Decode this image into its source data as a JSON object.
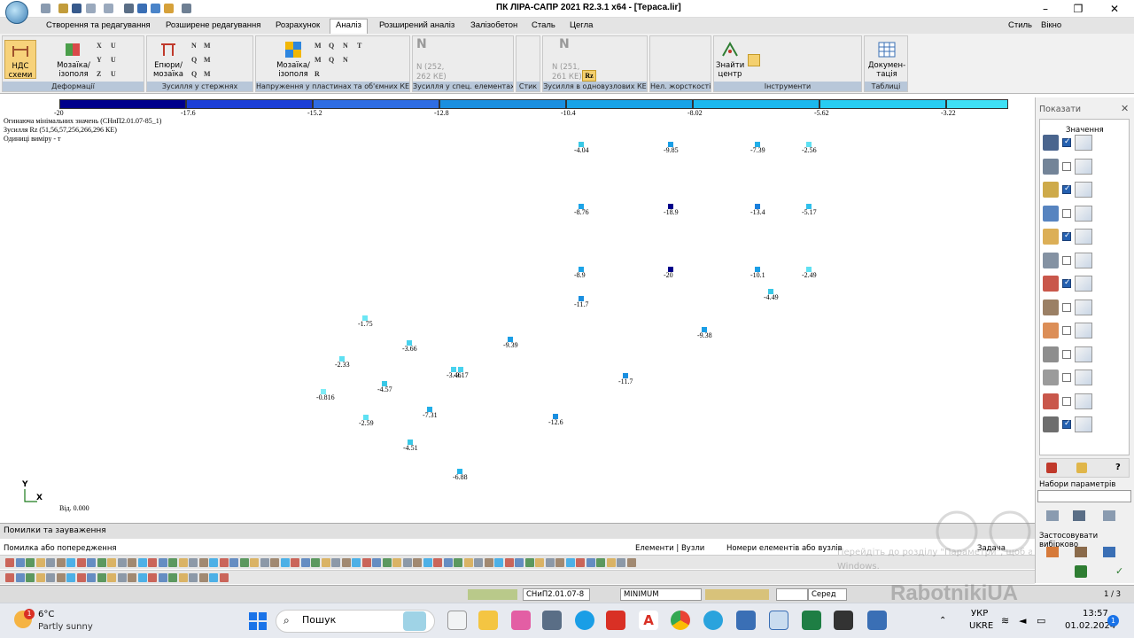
{
  "window": {
    "title": "ПК ЛІРА-САПР  2021 R2.3.1 x64 - [Тераса.lir]",
    "controls": [
      "–",
      "❐",
      "✕"
    ]
  },
  "menu": {
    "tabs": [
      "Створення та редагування",
      "Розширене редагування",
      "Розрахунок",
      "Аналіз",
      "Розширений аналіз",
      "Залізобетон",
      "Сталь",
      "Цегла"
    ],
    "right": [
      "Стиль",
      "Вікно"
    ],
    "active_index": 3
  },
  "ribbon": {
    "groups": [
      {
        "label": "Деформації",
        "buttons": [
          "НДС схеми",
          "Мозаїка/ізополя"
        ],
        "small": [
          "X",
          "Y",
          "Z",
          "U",
          "U",
          "U"
        ]
      },
      {
        "label": "Зусилля у стержнях",
        "buttons": [
          "Епюри/мозаїка"
        ],
        "small": [
          "N",
          "M",
          "Q",
          "M",
          "Q",
          "M"
        ]
      },
      {
        "label": "Напруження у пластинах та об'ємних КЕ",
        "buttons": [
          "Мозаїка/ізополя"
        ],
        "small": [
          "M",
          "Q",
          "N",
          "T",
          "M",
          "Q",
          "N",
          "R"
        ]
      },
      {
        "label": "Зусилля у спец. елементах",
        "disabled_text": [
          "N (252,",
          "262 КЕ)"
        ]
      },
      {
        "label": "Стик"
      },
      {
        "label": "Зусилля в одновузлових КЕ",
        "disabled_text": [
          "N (251,",
          "261 КЕ)"
        ],
        "selected": "Rz"
      },
      {
        "label": "Нел. жорсткості"
      },
      {
        "label": "Інструменти",
        "buttons": [
          "Знайти центр"
        ]
      },
      {
        "label": "Таблиці",
        "buttons": [
          "Докумен-тація"
        ]
      }
    ]
  },
  "scale": {
    "labels": [
      "-20",
      "-17.6",
      "-15.2",
      "-12.8",
      "-10.4",
      "-8.02",
      "-5.62",
      "-3.22"
    ],
    "colors": [
      "#00008b",
      "#1c3fd6",
      "#2f6de3",
      "#1a8fe0",
      "#18a3e8",
      "#1bb8ee",
      "#27cdf2",
      "#3fe0f5"
    ]
  },
  "canvas": {
    "info": [
      "Огинаюча мінімальних значень (СНиП2.01.07-85_1)",
      "Зусилля Rz (51,56,57,256,266,296 КЕ)",
      "Одиниці виміру - т"
    ],
    "axis_y": "Y",
    "axis_x": "X",
    "offset_label": "Від. 0.000",
    "points": [
      {
        "v": "-4.04",
        "c": "#39c8e6"
      },
      {
        "v": "-9.85",
        "c": "#1a9ee6"
      },
      {
        "v": "-7.39",
        "c": "#22aee8"
      },
      {
        "v": "-2.56",
        "c": "#5ee0f2"
      },
      {
        "v": "-8.76",
        "c": "#1ca4e8"
      },
      {
        "v": "-18.9",
        "c": "#00008b"
      },
      {
        "v": "-13.4",
        "c": "#1a7fdc"
      },
      {
        "v": "-5.17",
        "c": "#2fc0ec"
      },
      {
        "v": "-8.9",
        "c": "#1ca4e8"
      },
      {
        "v": "-20",
        "c": "#00008b"
      },
      {
        "v": "-10.1",
        "c": "#1a9ee6"
      },
      {
        "v": "-2.49",
        "c": "#5ee0f2"
      },
      {
        "v": "-11.7",
        "c": "#1a8fe0"
      },
      {
        "v": "-4.49",
        "c": "#39c8e6"
      },
      {
        "v": "-1.75",
        "c": "#6be6f4"
      },
      {
        "v": "-9.39",
        "c": "#1a9ee6"
      },
      {
        "v": "-9.38",
        "c": "#1a9ee6"
      },
      {
        "v": "-3.66",
        "c": "#48d2ee"
      },
      {
        "v": "-2.33",
        "c": "#5ee0f2"
      },
      {
        "v": "-3.46",
        "c": "#48d2ee"
      },
      {
        "v": "-3.17",
        "c": "#48d2ee"
      },
      {
        "v": "-11.7",
        "c": "#1a8fe0"
      },
      {
        "v": "-4.57",
        "c": "#39c8e6"
      },
      {
        "v": "-0.816",
        "c": "#7eecf6"
      },
      {
        "v": "-7.31",
        "c": "#22aee8"
      },
      {
        "v": "-2.59",
        "c": "#5ee0f2"
      },
      {
        "v": "-12.6",
        "c": "#1a8fe0"
      },
      {
        "v": "-4.51",
        "c": "#39c8e6"
      },
      {
        "v": "-6.88",
        "c": "#26b6ea"
      }
    ]
  },
  "panel": {
    "title": "Показати",
    "values_label": "Значення",
    "checks": [
      true,
      false,
      true,
      false,
      true,
      false,
      true,
      false,
      false,
      false,
      false,
      false,
      true
    ],
    "params_label": "Набори параметрів",
    "apply_label": "Застосовувати вибірково"
  },
  "errors": {
    "header": "Помилки та зауваження",
    "columns": [
      "Помилка або попередження",
      "Елементи | Вузли",
      "Номери елементів або вузлів",
      "Задача"
    ]
  },
  "status": {
    "norm": "СНиП2.01.07-8",
    "mode": "MINIMUM",
    "avg": "Серед",
    "page": "1 / 3"
  },
  "watermark": {
    "activate": "Перейдіть до розділу \"Параметри\", щоб активувати",
    "windows": "Windows.",
    "brand": "RabotnikiUA"
  },
  "taskbar": {
    "weather_temp": "6°C",
    "weather_desc": "Partly sunny",
    "badge": "1",
    "search": "Пошук",
    "lang1": "УКР",
    "lang2": "UKRE",
    "time": "13:57",
    "date": "01.02.2024",
    "notif": "1"
  }
}
